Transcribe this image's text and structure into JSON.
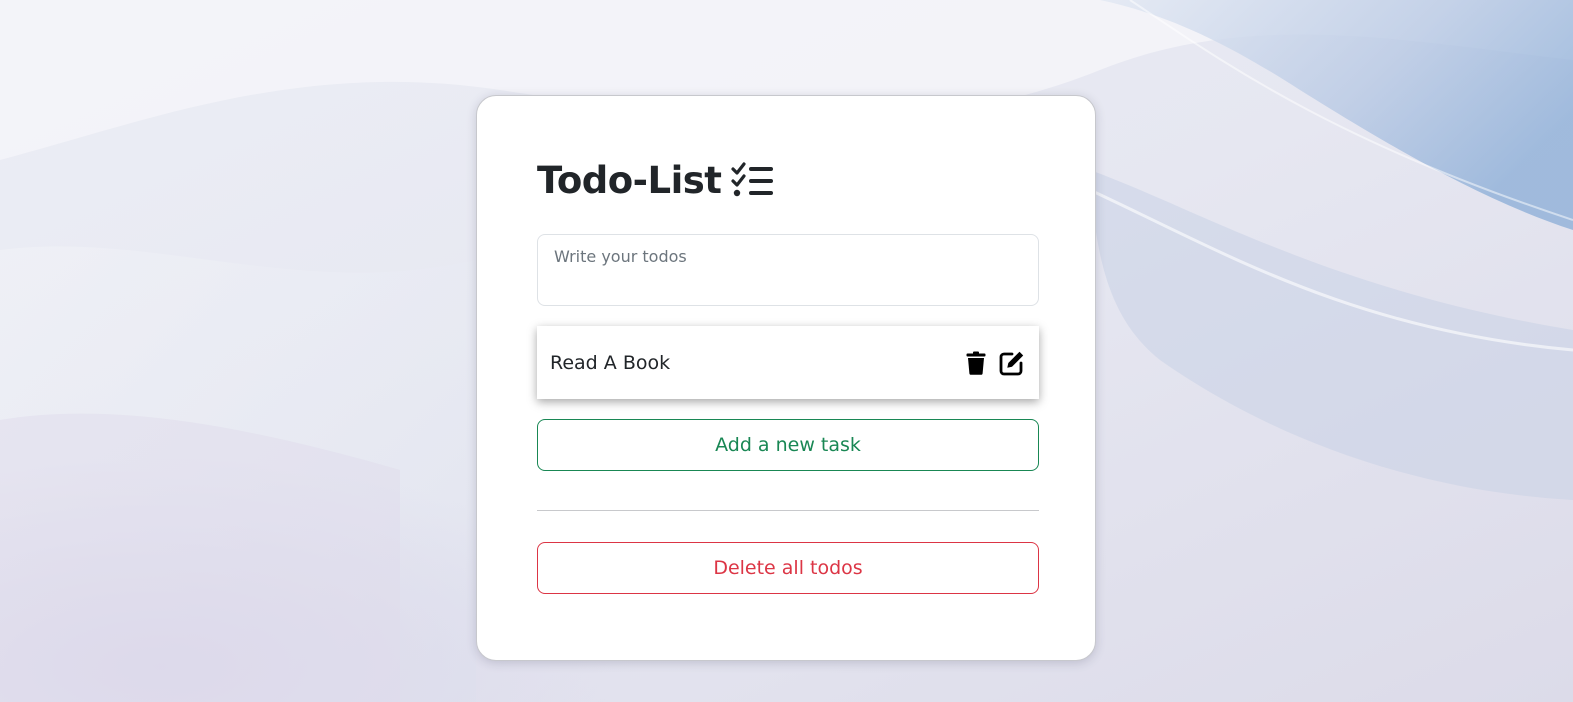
{
  "header": {
    "title": "Todo-List",
    "title_icon": "list-check-icon"
  },
  "input": {
    "placeholder": "Write your todos",
    "value": ""
  },
  "todos": [
    {
      "text": "Read A Book",
      "delete_icon": "trash-icon",
      "edit_icon": "edit-icon"
    }
  ],
  "actions": {
    "add_label": "Add a new task",
    "delete_all_label": "Delete all todos"
  },
  "colors": {
    "success": "#198754",
    "danger": "#dc3545",
    "text": "#212529",
    "placeholder": "#6c757d"
  }
}
